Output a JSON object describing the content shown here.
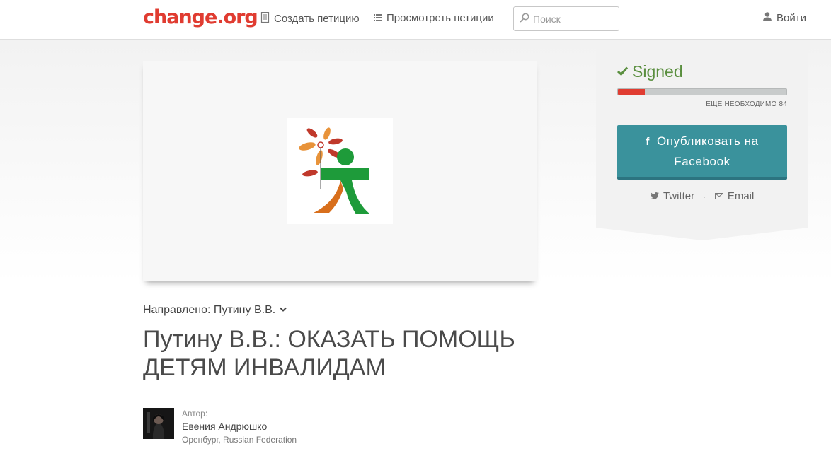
{
  "header": {
    "logo": "change.org",
    "nav": {
      "create_label": "Создать петицию",
      "browse_label": "Просмотреть петиции"
    },
    "search": {
      "placeholder": "Поиск",
      "value": ""
    },
    "login_label": "Войти"
  },
  "petition": {
    "target_label": "Направлено: Путину В.В.",
    "title": "Путину В.В.: ОКАЗАТЬ ПОМОЩЬ ДЕТЯМ ИНВАЛИДАМ",
    "author": {
      "label": "Автор:",
      "name": "Евения Андрюшко",
      "location": "Оренбург, Russian Federation"
    }
  },
  "sidebar": {
    "status": "Signed",
    "progress_fraction": 0.16,
    "needed_label": "ЕЩЕ НЕОБХОДИМО 84",
    "facebook_button": "Опубликовать на Facebook",
    "share": {
      "twitter": "Twitter",
      "email": "Email"
    }
  },
  "colors": {
    "brand": "#e03c31",
    "signed_green": "#5a8f3f",
    "facebook_button": "#3a929c",
    "progress_track": "#c8cbcb"
  },
  "icons": [
    "petition-icon",
    "list-icon",
    "search-icon",
    "user-icon",
    "check-icon",
    "chevron-down-icon",
    "facebook-icon",
    "twitter-icon",
    "email-icon"
  ]
}
